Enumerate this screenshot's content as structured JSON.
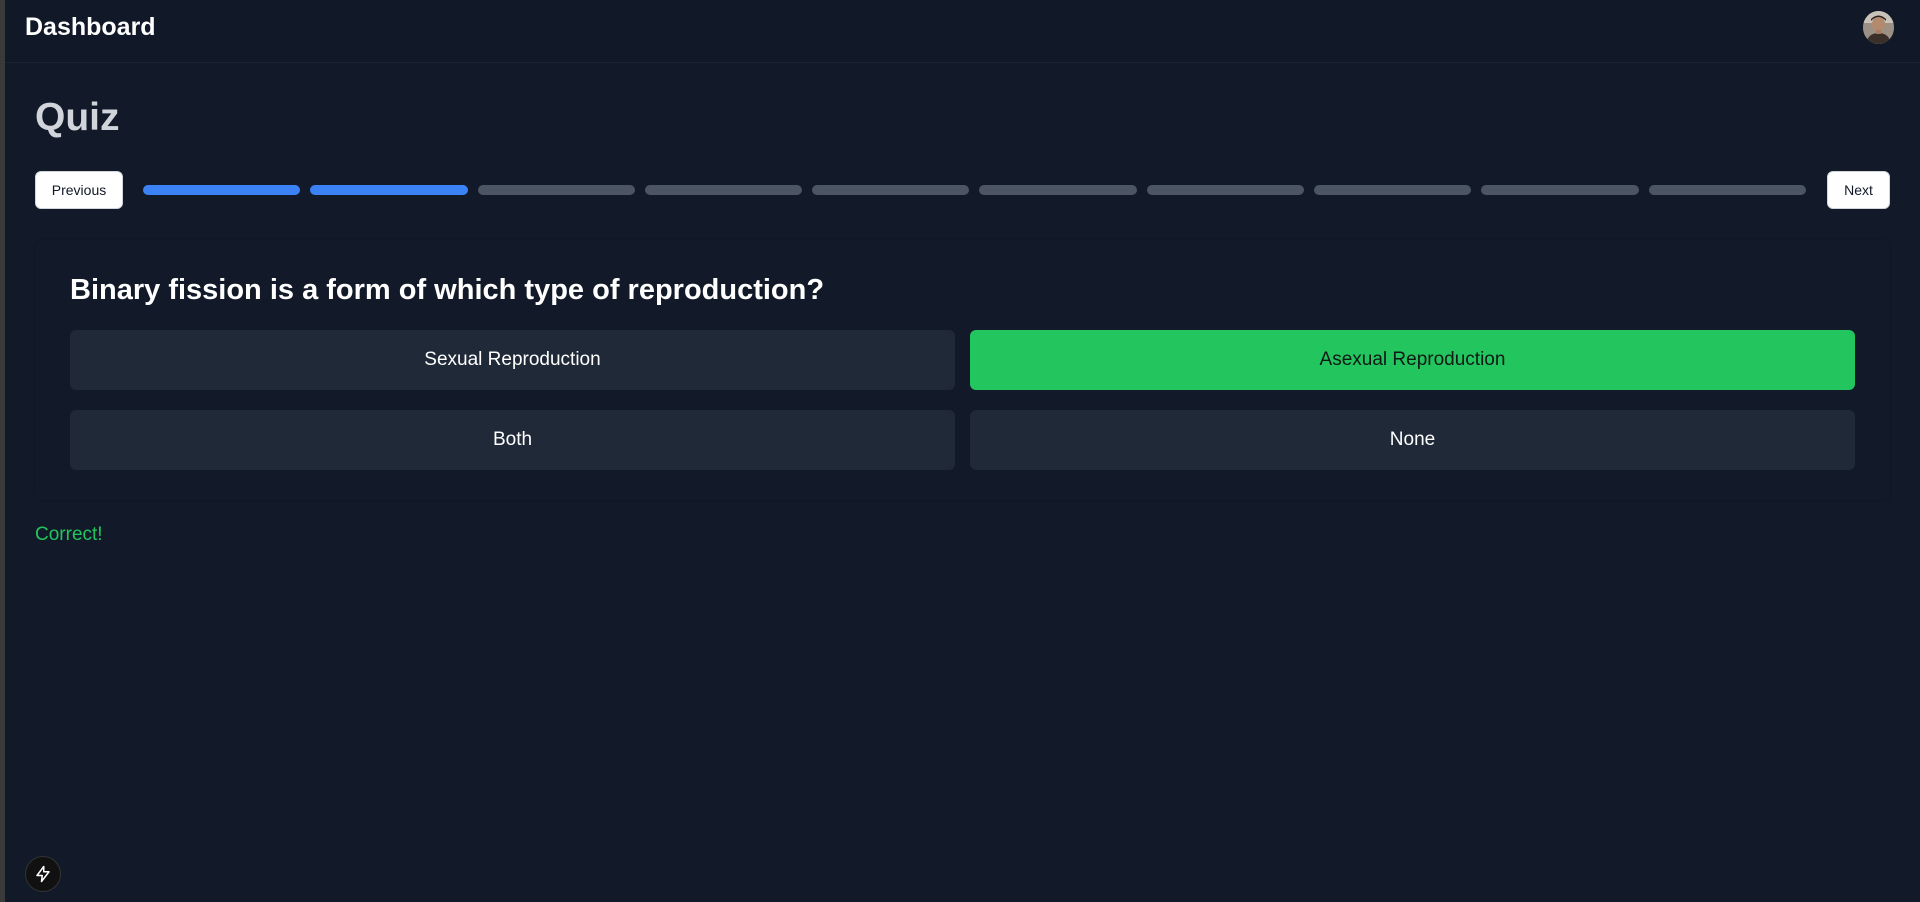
{
  "header": {
    "title": "Dashboard",
    "avatar_icon": "user-avatar"
  },
  "page": {
    "title": "Quiz"
  },
  "navigation": {
    "previous_label": "Previous",
    "next_label": "Next"
  },
  "progress": {
    "total_steps": 10,
    "completed_steps": 2,
    "done_color": "#3b82f6",
    "pending_color": "#4b5563"
  },
  "question": {
    "text": "Binary fission is a form of which type of reproduction?",
    "options": [
      {
        "label": "Sexual Reproduction",
        "state": "default"
      },
      {
        "label": "Asexual Reproduction",
        "state": "correct"
      },
      {
        "label": "Both",
        "state": "default"
      },
      {
        "label": "None",
        "state": "default"
      }
    ]
  },
  "feedback": {
    "text": "Correct!",
    "color": "#22c55e"
  },
  "fab": {
    "icon": "lightning-bolt-icon"
  },
  "colors": {
    "background": "#121a29",
    "topbar": "#111827",
    "option_bg": "#1f2937",
    "correct": "#22c55e"
  }
}
